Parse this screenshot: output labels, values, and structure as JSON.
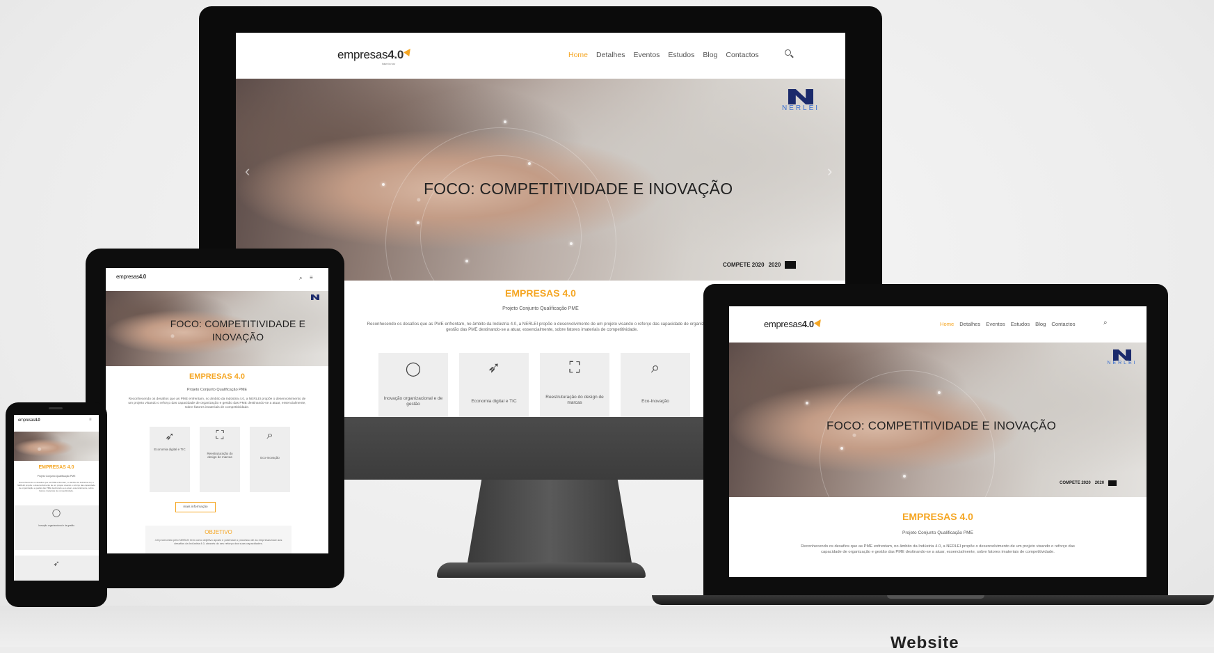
{
  "site": {
    "logo_word": "empresas",
    "logo_num": "4.0",
    "logo_tag": "future is now",
    "menu": [
      "Home",
      "Detalhes",
      "Eventos",
      "Estudos",
      "Blog",
      "Contactos"
    ],
    "search_icon": "search-icon",
    "hero_title": "FOCO: COMPETITIVIDADE E INOVAÇÃO",
    "partner_logo": "NERLEI",
    "funding_logos": {
      "compete": "COMPETE 2020",
      "p2020": "2020"
    },
    "heading": "EMPRESAS 4.0",
    "subheading": "Projeto Conjunto Qualificação PME",
    "intro": "Reconhecendo os desafios que as PME enfrentam, no âmbito da Indústria 4.0, a NERLEI propõe o desenvolvimento de um projeto visando o reforço das capacidade de organização e gestão das PME destinando-se a atuar, essencialmente, sobre fatores imateriais de competitividade.",
    "cards": [
      {
        "icon": "lightbulb-icon",
        "label": "Inovação organizacional e de gestão"
      },
      {
        "icon": "paper-plane-icon",
        "label": "Economia digital e TIC"
      },
      {
        "icon": "expand-icon",
        "label": "Reestruturação do design de marcas"
      },
      {
        "icon": "search-icon",
        "label": "Eco-Inovação"
      }
    ],
    "more_button": "mais informação",
    "objective_heading": "OBJETIVO",
    "objective_text": "4.0 promovido pelo NERLEI tem como objetivo apoiar e potenciar o processo de as empresas face aos desafios da Indústria 4.0, através do seu reforço das suas capacidades."
  },
  "caption": "Website",
  "colors": {
    "accent": "#f5a623",
    "partner": "#1b2a6b",
    "device": "#0d0d0d",
    "stand": "#4a4a4a"
  }
}
